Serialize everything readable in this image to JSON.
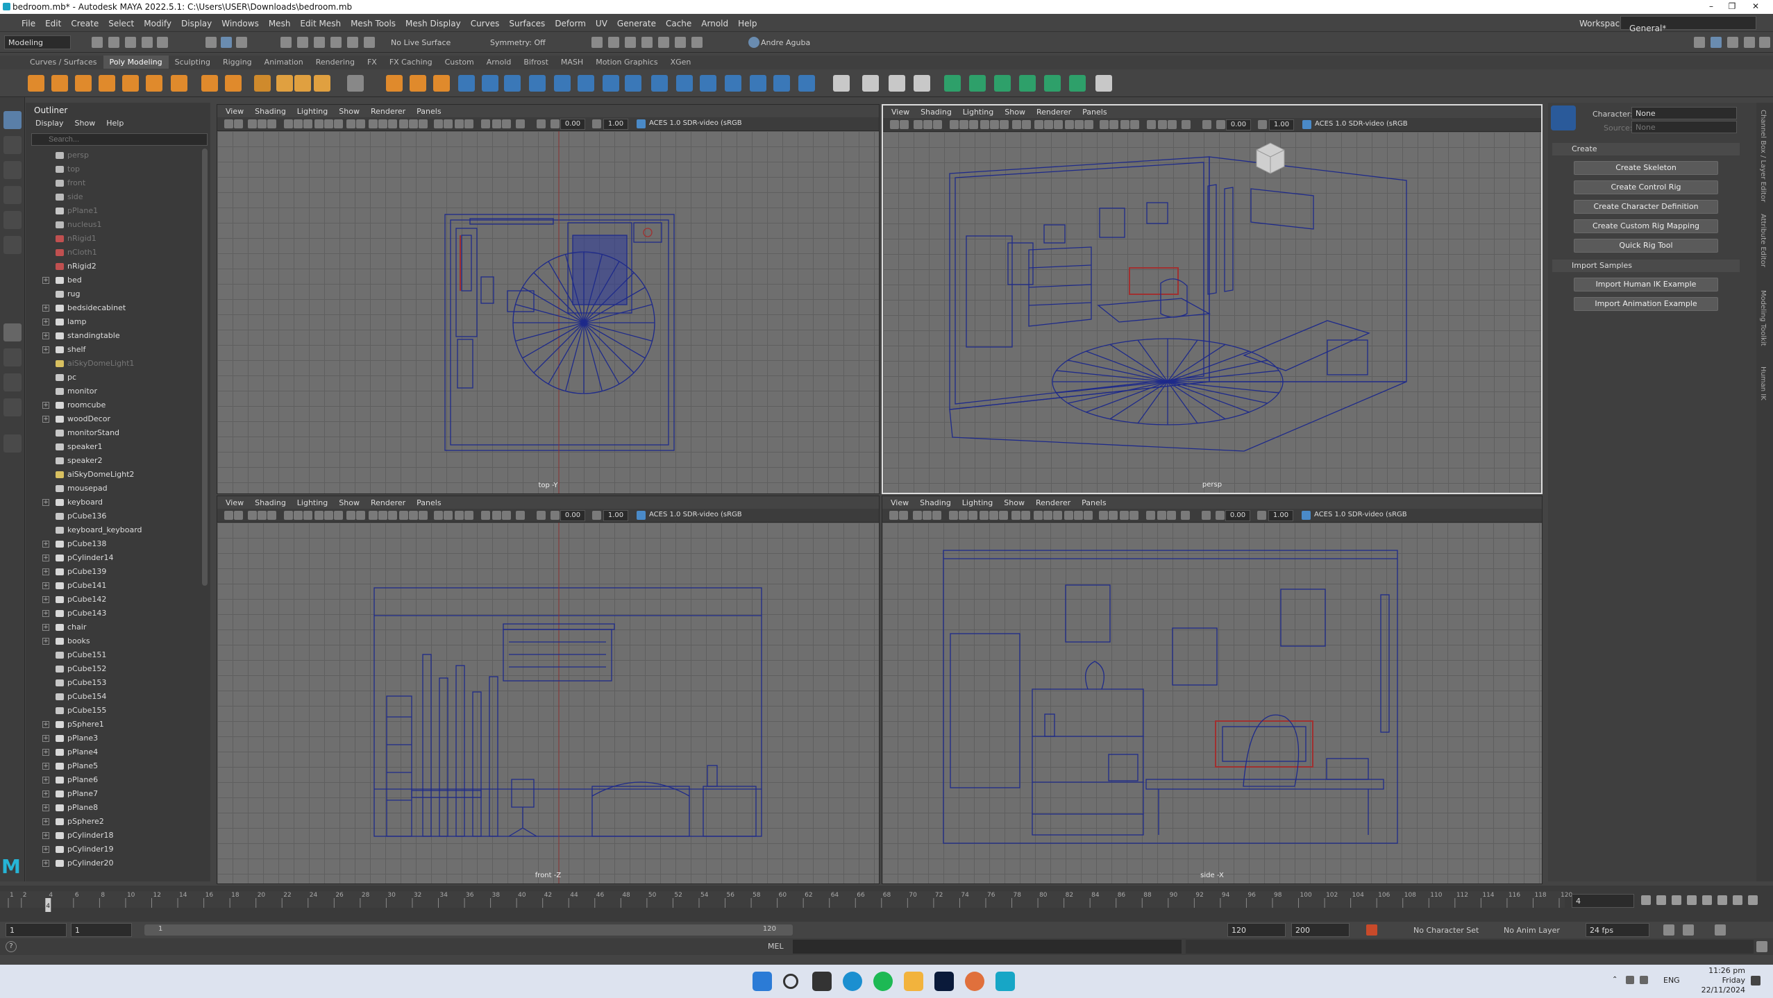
{
  "window": {
    "title": "bedroom.mb* - Autodesk MAYA 2022.5.1: C:\\Users\\USER\\Downloads\\bedroom.mb"
  },
  "menu": [
    "File",
    "Edit",
    "Create",
    "Select",
    "Modify",
    "Display",
    "Windows",
    "Mesh",
    "Edit Mesh",
    "Mesh Tools",
    "Mesh Display",
    "Curves",
    "Surfaces",
    "Deform",
    "UV",
    "Generate",
    "Cache",
    "Arnold",
    "Help"
  ],
  "workspace": {
    "label": "Workspace:",
    "value": "General*"
  },
  "status_line": {
    "mode": "Modeling",
    "live_surface": "No Live Surface",
    "symmetry": "Symmetry: Off",
    "user": "Andre Aguba"
  },
  "shelf_tabs": [
    "Curves / Surfaces",
    "Poly Modeling",
    "Sculpting",
    "Rigging",
    "Animation",
    "Rendering",
    "FX",
    "FX Caching",
    "Custom",
    "Arnold",
    "Bifrost",
    "MASH",
    "Motion Graphics",
    "XGen"
  ],
  "shelf_active": "Poly Modeling",
  "outliner": {
    "title": "Outliner",
    "menu": [
      "Display",
      "Show",
      "Help"
    ],
    "search_placeholder": "Search...",
    "items": [
      {
        "label": "persp",
        "expand": false,
        "dim": true,
        "icon": "camera"
      },
      {
        "label": "top",
        "expand": false,
        "dim": true,
        "icon": "camera"
      },
      {
        "label": "front",
        "expand": false,
        "dim": true,
        "icon": "camera"
      },
      {
        "label": "side",
        "expand": false,
        "dim": true,
        "icon": "camera"
      },
      {
        "label": "pPlane1",
        "expand": false,
        "dim": true,
        "icon": "mesh"
      },
      {
        "label": "nucleus1",
        "expand": false,
        "dim": true,
        "icon": "nucleus"
      },
      {
        "label": "nRigid1",
        "expand": false,
        "dim": true,
        "icon": "rigid"
      },
      {
        "label": "nCloth1",
        "expand": false,
        "dim": true,
        "icon": "cloth"
      },
      {
        "label": "nRigid2",
        "expand": false,
        "dim": false,
        "icon": "rigid"
      },
      {
        "label": "bed",
        "expand": true,
        "dim": false,
        "icon": "group"
      },
      {
        "label": "rug",
        "expand": false,
        "dim": false,
        "icon": "mesh"
      },
      {
        "label": "bedsidecabinet",
        "expand": true,
        "dim": false,
        "icon": "group"
      },
      {
        "label": "lamp",
        "expand": true,
        "dim": false,
        "icon": "group"
      },
      {
        "label": "standingtable",
        "expand": true,
        "dim": false,
        "icon": "group"
      },
      {
        "label": "shelf",
        "expand": true,
        "dim": false,
        "icon": "group"
      },
      {
        "label": "aiSkyDomeLight1",
        "expand": false,
        "dim": true,
        "icon": "light"
      },
      {
        "label": "pc",
        "expand": false,
        "dim": false,
        "icon": "mesh"
      },
      {
        "label": "monitor",
        "expand": false,
        "dim": false,
        "icon": "mesh"
      },
      {
        "label": "roomcube",
        "expand": true,
        "dim": false,
        "icon": "group"
      },
      {
        "label": "woodDecor",
        "expand": true,
        "dim": false,
        "icon": "group"
      },
      {
        "label": "monitorStand",
        "expand": false,
        "dim": false,
        "icon": "mesh"
      },
      {
        "label": "speaker1",
        "expand": false,
        "dim": false,
        "icon": "mesh"
      },
      {
        "label": "speaker2",
        "expand": false,
        "dim": false,
        "icon": "mesh"
      },
      {
        "label": "aiSkyDomeLight2",
        "expand": false,
        "dim": false,
        "icon": "light"
      },
      {
        "label": "mousepad",
        "expand": false,
        "dim": false,
        "icon": "mesh"
      },
      {
        "label": "keyboard",
        "expand": true,
        "dim": false,
        "icon": "group"
      },
      {
        "label": "pCube136",
        "expand": false,
        "dim": false,
        "icon": "mesh"
      },
      {
        "label": "keyboard_keyboard",
        "expand": false,
        "dim": false,
        "icon": "mesh"
      },
      {
        "label": "pCube138",
        "expand": true,
        "dim": false,
        "icon": "group"
      },
      {
        "label": "pCylinder14",
        "expand": true,
        "dim": false,
        "icon": "group"
      },
      {
        "label": "pCube139",
        "expand": true,
        "dim": false,
        "icon": "group"
      },
      {
        "label": "pCube141",
        "expand": true,
        "dim": false,
        "icon": "group"
      },
      {
        "label": "pCube142",
        "expand": true,
        "dim": false,
        "icon": "group"
      },
      {
        "label": "pCube143",
        "expand": true,
        "dim": false,
        "icon": "group"
      },
      {
        "label": "chair",
        "expand": true,
        "dim": false,
        "icon": "group"
      },
      {
        "label": "books",
        "expand": true,
        "dim": false,
        "icon": "group"
      },
      {
        "label": "pCube151",
        "expand": false,
        "dim": false,
        "icon": "mesh"
      },
      {
        "label": "pCube152",
        "expand": false,
        "dim": false,
        "icon": "mesh"
      },
      {
        "label": "pCube153",
        "expand": false,
        "dim": false,
        "icon": "mesh"
      },
      {
        "label": "pCube154",
        "expand": false,
        "dim": false,
        "icon": "mesh"
      },
      {
        "label": "pCube155",
        "expand": false,
        "dim": false,
        "icon": "mesh"
      },
      {
        "label": "pSphere1",
        "expand": true,
        "dim": false,
        "icon": "group"
      },
      {
        "label": "pPlane3",
        "expand": true,
        "dim": false,
        "icon": "group"
      },
      {
        "label": "pPlane4",
        "expand": true,
        "dim": false,
        "icon": "group"
      },
      {
        "label": "pPlane5",
        "expand": true,
        "dim": false,
        "icon": "group"
      },
      {
        "label": "pPlane6",
        "expand": true,
        "dim": false,
        "icon": "group"
      },
      {
        "label": "pPlane7",
        "expand": true,
        "dim": false,
        "icon": "group"
      },
      {
        "label": "pPlane8",
        "expand": true,
        "dim": false,
        "icon": "group"
      },
      {
        "label": "pSphere2",
        "expand": true,
        "dim": false,
        "icon": "group"
      },
      {
        "label": "pCylinder18",
        "expand": true,
        "dim": false,
        "icon": "group"
      },
      {
        "label": "pCylinder19",
        "expand": true,
        "dim": false,
        "icon": "group"
      },
      {
        "label": "pCylinder20",
        "expand": true,
        "dim": false,
        "icon": "group"
      }
    ]
  },
  "viewports": {
    "menu": [
      "View",
      "Shading",
      "Lighting",
      "Show",
      "Renderer",
      "Panels"
    ],
    "exposure": "0.00",
    "gamma": "1.00",
    "colorspace": "ACES 1.0 SDR-video (sRGB",
    "labels": {
      "top": "top -Y",
      "persp": "persp",
      "front": "front -Z",
      "side": "side -X"
    }
  },
  "hik": {
    "character_label": "Character:",
    "character_value": "None",
    "source_label": "Source:",
    "source_value": "None",
    "create_section": "Create",
    "create_buttons": [
      "Create Skeleton",
      "Create Control Rig",
      "Create Character Definition",
      "Create Custom Rig Mapping",
      "Quick Rig Tool"
    ],
    "import_section": "Import Samples",
    "import_buttons": [
      "Import Human IK Example",
      "Import Animation Example"
    ]
  },
  "side_tabs": [
    "Channel Box / Layer Editor",
    "Attribute Editor",
    "Modeling Toolkit",
    "Human IK"
  ],
  "timeline": {
    "ticks": [
      "1",
      "2",
      "4",
      "6",
      "8",
      "10",
      "12",
      "14",
      "16",
      "18",
      "20",
      "22",
      "24",
      "26",
      "28",
      "30",
      "32",
      "34",
      "36",
      "38",
      "40",
      "42",
      "44",
      "46",
      "48",
      "50",
      "52",
      "54",
      "56",
      "58",
      "60",
      "62",
      "64",
      "66",
      "68",
      "70",
      "72",
      "74",
      "76",
      "78",
      "80",
      "82",
      "84",
      "86",
      "88",
      "90",
      "92",
      "94",
      "96",
      "98",
      "100",
      "102",
      "104",
      "106",
      "108",
      "110",
      "112",
      "114",
      "116",
      "118",
      "120"
    ],
    "current_frame": "4",
    "current_field": "4"
  },
  "range": {
    "start_field": "1",
    "start_inner": "1",
    "slider_start": "1",
    "slider_end": "120",
    "end_inner": "120",
    "end_field": "200",
    "character_set": "No Character Set",
    "anim_layer": "No Anim Layer",
    "fps": "24 fps"
  },
  "command_line": {
    "label": "MEL"
  },
  "taskbar": {
    "time": "11:26 pm",
    "day": "Friday",
    "date": "22/11/2024",
    "lang": "ENG"
  }
}
